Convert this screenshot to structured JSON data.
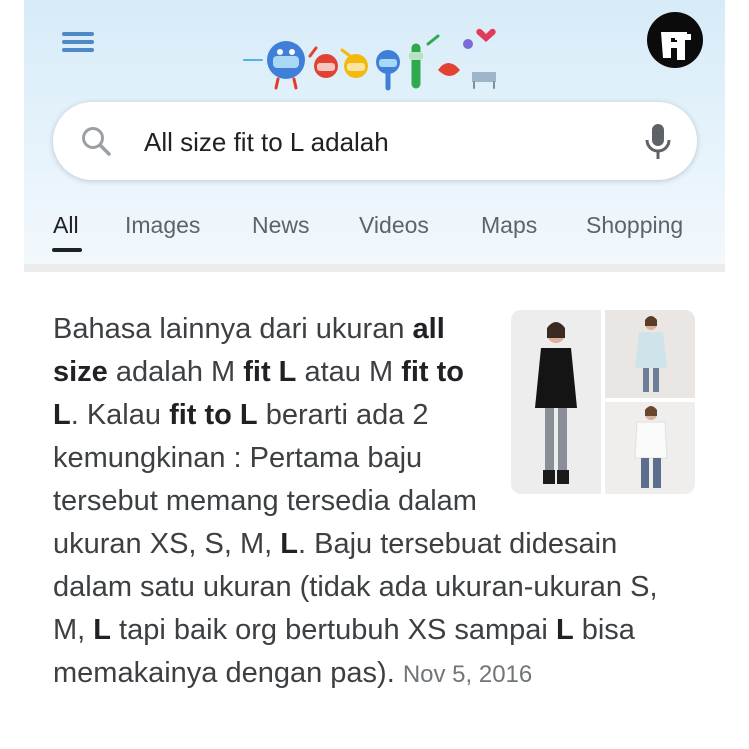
{
  "colors": {
    "header_bg": "#dcedf9",
    "tab_active": "#202124",
    "tab_inactive": "#5f6368",
    "date": "#70757a"
  },
  "header": {
    "menu_icon": "hamburger-menu-icon",
    "logo": "google-doodle-logo",
    "avatar_icon": "account-avatar-icon"
  },
  "search": {
    "icon": "search-icon",
    "query": "All size fit to L adalah",
    "mic_icon": "microphone-icon"
  },
  "tabs": [
    {
      "label": "All",
      "active": true
    },
    {
      "label": "Images"
    },
    {
      "label": "News"
    },
    {
      "label": "Videos"
    },
    {
      "label": "Maps"
    },
    {
      "label": "Shopping"
    }
  ],
  "result": {
    "snippet": [
      {
        "t": "Bahasa lainnya dari ukuran "
      },
      {
        "t": "all size",
        "b": true
      },
      {
        "t": " adalah M "
      },
      {
        "t": "fit L",
        "b": true
      },
      {
        "t": " atau M "
      },
      {
        "t": "fit to L",
        "b": true
      },
      {
        "t": ". Kalau "
      },
      {
        "t": "fit to L",
        "b": true
      },
      {
        "t": " berarti ada 2 kemungkinan : Pertama baju tersebut memang tersedia dalam ukuran XS, S, M, "
      },
      {
        "t": "L",
        "b": true
      },
      {
        "t": ". Baju tersebuat didesain dalam satu ukuran (tidak ada ukuran-ukuran S, M, "
      },
      {
        "t": "L",
        "b": true
      },
      {
        "t": " tapi baik org bertubuh XS sampai "
      },
      {
        "t": "L",
        "b": true
      },
      {
        "t": " bisa memakainya dengan pas). "
      }
    ],
    "date": "Nov 5, 2016",
    "image": "clothing-model-photos-thumbnail"
  }
}
